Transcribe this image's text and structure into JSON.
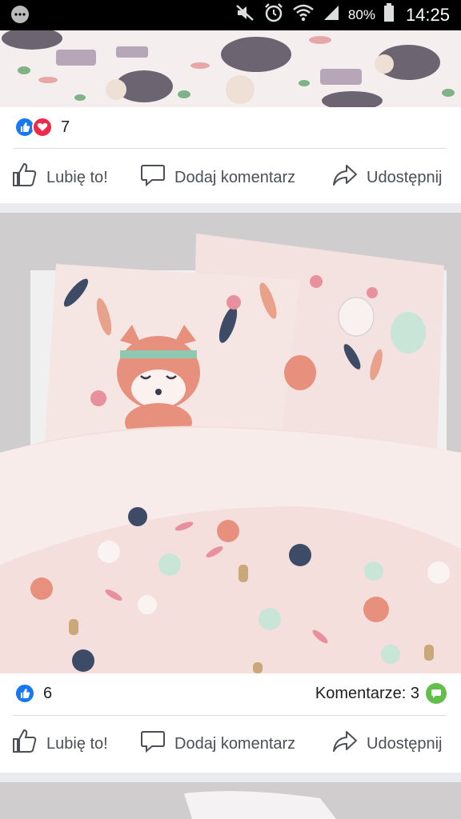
{
  "status_bar": {
    "battery": "80%",
    "time": "14:25",
    "icons": [
      "messenger-icon",
      "mute-icon",
      "alarm-icon",
      "wifi-icon",
      "signal-icon",
      "battery-icon"
    ]
  },
  "post1": {
    "image": "hedgehog-pattern-bedding",
    "reaction_count": "7",
    "actions": {
      "like": "Lubię to!",
      "comment": "Dodaj komentarz",
      "share": "Udostępnij"
    }
  },
  "post2": {
    "image": "fox-pattern-bedding",
    "reaction_count": "6",
    "comments_label": "Komentarze: 3",
    "actions": {
      "like": "Lubię to!",
      "comment": "Dodaj komentarz",
      "share": "Udostępnij"
    }
  },
  "colors": {
    "like_blue": "#1877f2",
    "love_red": "#f02849",
    "comment_green": "#63be4b",
    "bedding_pink": "#f2dedb"
  }
}
